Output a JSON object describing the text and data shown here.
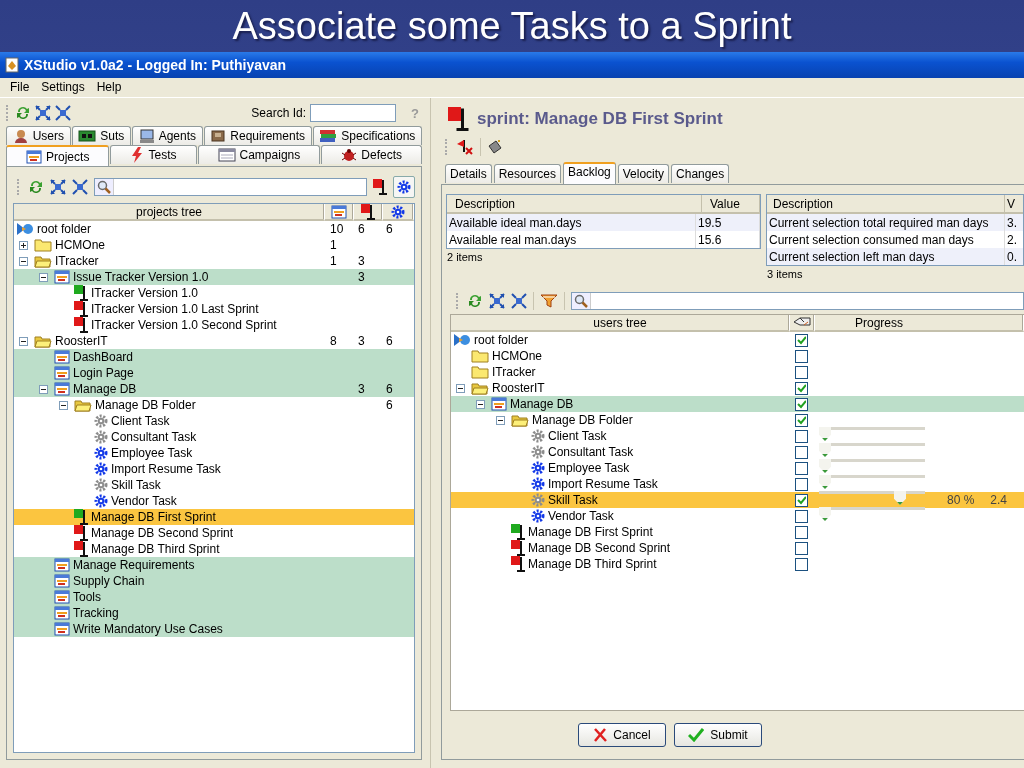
{
  "slide_title": "Associate some Tasks to a Sprint",
  "window": {
    "title": "XStudio v1.0a2 - Logged In: Puthiyavan"
  },
  "menu": [
    {
      "label": "File"
    },
    {
      "label": "Settings"
    },
    {
      "label": "Help"
    }
  ],
  "left_toolbar": {
    "search_label": "Search Id:",
    "help": "?"
  },
  "tab_rows": [
    [
      {
        "label": "Users",
        "kind": "users",
        "selected": false
      },
      {
        "label": "Suts",
        "kind": "suts",
        "selected": false
      },
      {
        "label": "Agents",
        "kind": "agents",
        "selected": false
      },
      {
        "label": "Requirements",
        "kind": "requirements",
        "selected": false
      },
      {
        "label": "Specifications",
        "kind": "specifications",
        "selected": false
      }
    ],
    [
      {
        "label": "Projects",
        "kind": "projects",
        "selected": true
      },
      {
        "label": "Tests",
        "kind": "tests",
        "selected": false
      },
      {
        "label": "Campaigns",
        "kind": "campaigns",
        "selected": false
      },
      {
        "label": "Defects",
        "kind": "defects",
        "selected": false
      }
    ]
  ],
  "projects_tree": {
    "header": "projects tree",
    "items": [
      {
        "label": "root folder",
        "kind": "root",
        "selected": false,
        "column_2": "10",
        "column_3": "6",
        "column_4": "6",
        "children": [
          {
            "label": "HCMOne",
            "kind": "folder",
            "selected": false,
            "expanded": false,
            "column_2": "1"
          },
          {
            "label": "ITracker",
            "kind": "folder",
            "selected": false,
            "expanded": true,
            "column_2": "1",
            "column_3": "3",
            "children": [
              {
                "label": "Issue Tracker Version 1.0",
                "kind": "project",
                "selected": false,
                "expanded": true,
                "column_3": "3",
                "children": [
                  {
                    "label": "ITracker Version 1.0",
                    "kind": "sprint",
                    "color": "#1faa1f",
                    "selected": false
                  },
                  {
                    "label": "ITracker Version 1.0 Last Sprint",
                    "kind": "sprint",
                    "color": "#e01818",
                    "selected": false
                  },
                  {
                    "label": "ITracker Version 1.0 Second Sprint",
                    "kind": "sprint",
                    "color": "#e01818",
                    "selected": false
                  }
                ]
              }
            ]
          },
          {
            "label": "RoosterIT",
            "kind": "folder",
            "selected": false,
            "expanded": true,
            "column_2": "8",
            "column_3": "3",
            "column_4": "6",
            "children": [
              {
                "label": "DashBoard",
                "kind": "project",
                "selected": false
              },
              {
                "label": "Login Page",
                "kind": "project",
                "selected": false
              },
              {
                "label": "Manage DB",
                "kind": "project",
                "selected": false,
                "expanded": true,
                "column_3": "3",
                "column_4": "6",
                "children": [
                  {
                    "label": "Manage DB Folder",
                    "kind": "folder",
                    "selected": false,
                    "expanded": true,
                    "column_4": "6",
                    "children": [
                      {
                        "label": "Client Task",
                        "kind": "task",
                        "color": "#8c8c8c",
                        "selected": false
                      },
                      {
                        "label": "Consultant Task",
                        "kind": "task",
                        "color": "#8c8c8c",
                        "selected": false
                      },
                      {
                        "label": "Employee Task",
                        "kind": "task",
                        "color": "#1238e8",
                        "selected": false
                      },
                      {
                        "label": "Import Resume Task",
                        "kind": "task",
                        "color": "#1238e8",
                        "selected": false
                      },
                      {
                        "label": "Skill Task",
                        "kind": "task",
                        "color": "#8c8c8c",
                        "selected": false
                      },
                      {
                        "label": "Vendor Task",
                        "kind": "task",
                        "color": "#1238e8",
                        "selected": false
                      }
                    ]
                  },
                  {
                    "label": "Manage DB First Sprint",
                    "kind": "sprint",
                    "color": "#1faa1f",
                    "selected": true
                  },
                  {
                    "label": "Manage DB Second Sprint",
                    "kind": "sprint",
                    "color": "#e01818",
                    "selected": false
                  },
                  {
                    "label": "Manage DB Third Sprint",
                    "kind": "sprint",
                    "color": "#e01818",
                    "selected": false
                  }
                ]
              },
              {
                "label": "Manage Requirements",
                "kind": "project",
                "selected": false
              },
              {
                "label": "Supply Chain",
                "kind": "project",
                "selected": false
              },
              {
                "label": "Tools",
                "kind": "project",
                "selected": false
              },
              {
                "label": "Tracking",
                "kind": "project",
                "selected": false
              },
              {
                "label": "Write Mandatory Use Cases",
                "kind": "project",
                "selected": false
              }
            ]
          }
        ]
      }
    ]
  },
  "sprint": {
    "title": "sprint: Manage DB First Sprint"
  },
  "sprint_tabs": [
    {
      "label": "Details",
      "selected": false
    },
    {
      "label": "Resources",
      "selected": false
    },
    {
      "label": "Backlog",
      "selected": true
    },
    {
      "label": "Velocity",
      "selected": false
    },
    {
      "label": "Changes",
      "selected": false
    }
  ],
  "tables": [
    {
      "columns": [
        "Description",
        "Value"
      ],
      "rows": [
        [
          "Available ideal man.days",
          "19.5"
        ],
        [
          "Available real man.days",
          "15.6"
        ]
      ],
      "footer": "2 items"
    },
    {
      "columns": [
        "Description",
        "V"
      ],
      "rows": [
        [
          "Current selection total required man days",
          "3."
        ],
        [
          "Current selection consumed man days",
          "2."
        ],
        [
          "Current selection left man days",
          "0."
        ]
      ],
      "footer": "3 items"
    }
  ],
  "users_tree": {
    "header": "users tree",
    "progress_header": "Progress",
    "items": [
      {
        "label": "root folder",
        "kind": "root",
        "selected": false,
        "checked": true,
        "children": [
          {
            "label": "HCMOne",
            "kind": "folder",
            "selected": false,
            "checked": false
          },
          {
            "label": "ITracker",
            "kind": "folder",
            "selected": false,
            "checked": false
          },
          {
            "label": "RoosterIT",
            "kind": "folder",
            "selected": false,
            "expanded": true,
            "checked": true,
            "children": [
              {
                "label": "Manage DB",
                "kind": "project",
                "selected": false,
                "expanded": true,
                "checked": true,
                "children": [
                  {
                    "label": "Manage DB Folder",
                    "kind": "folder",
                    "selected": false,
                    "expanded": true,
                    "checked": true,
                    "children": [
                      {
                        "label": "Client Task",
                        "kind": "task",
                        "color": "#8c8c8c",
                        "selected": false,
                        "checked": false,
                        "level": 0
                      },
                      {
                        "label": "Consultant Task",
                        "kind": "task",
                        "color": "#8c8c8c",
                        "selected": false,
                        "checked": false,
                        "level": 0
                      },
                      {
                        "label": "Employee Task",
                        "kind": "task",
                        "color": "#1238e8",
                        "selected": false,
                        "checked": false,
                        "level": 0
                      },
                      {
                        "label": "Import Resume Task",
                        "kind": "task",
                        "color": "#1238e8",
                        "selected": false,
                        "checked": false,
                        "level": 0
                      },
                      {
                        "label": "Skill Task",
                        "kind": "task",
                        "color": "#8c8c8c",
                        "selected": true,
                        "checked": true,
                        "level": 0.8,
                        "percent": "80 %",
                        "value": "2.4"
                      },
                      {
                        "label": "Vendor Task",
                        "kind": "task",
                        "color": "#1238e8",
                        "selected": false,
                        "checked": false,
                        "level": 0
                      }
                    ]
                  },
                  {
                    "label": "Manage DB First Sprint",
                    "kind": "sprint",
                    "color": "#1faa1f",
                    "selected": false,
                    "checked": false
                  },
                  {
                    "label": "Manage DB Second Sprint",
                    "kind": "sprint",
                    "color": "#e01818",
                    "selected": false,
                    "checked": false
                  },
                  {
                    "label": "Manage DB Third Sprint",
                    "kind": "sprint",
                    "color": "#e01818",
                    "selected": false,
                    "checked": false
                  }
                ]
              }
            ]
          }
        ]
      }
    ]
  },
  "buttons": [
    {
      "label": "Cancel",
      "kind": "cancel"
    },
    {
      "label": "Submit",
      "kind": "submit"
    }
  ]
}
